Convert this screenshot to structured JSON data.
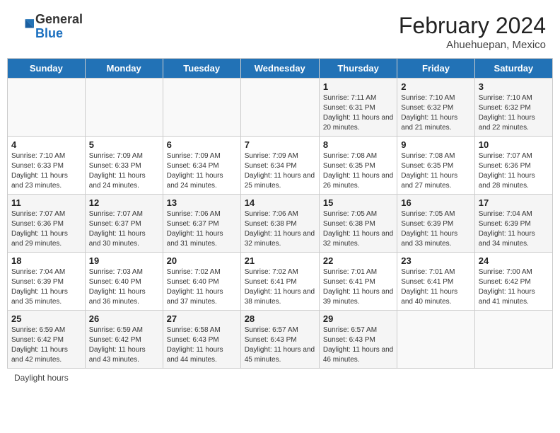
{
  "header": {
    "logo_general": "General",
    "logo_blue": "Blue",
    "month_year": "February 2024",
    "location": "Ahuehuepan, Mexico"
  },
  "calendar": {
    "days_of_week": [
      "Sunday",
      "Monday",
      "Tuesday",
      "Wednesday",
      "Thursday",
      "Friday",
      "Saturday"
    ],
    "weeks": [
      [
        {
          "day": "",
          "info": ""
        },
        {
          "day": "",
          "info": ""
        },
        {
          "day": "",
          "info": ""
        },
        {
          "day": "",
          "info": ""
        },
        {
          "day": "1",
          "info": "Sunrise: 7:11 AM\nSunset: 6:31 PM\nDaylight: 11 hours and 20 minutes."
        },
        {
          "day": "2",
          "info": "Sunrise: 7:10 AM\nSunset: 6:32 PM\nDaylight: 11 hours and 21 minutes."
        },
        {
          "day": "3",
          "info": "Sunrise: 7:10 AM\nSunset: 6:32 PM\nDaylight: 11 hours and 22 minutes."
        }
      ],
      [
        {
          "day": "4",
          "info": "Sunrise: 7:10 AM\nSunset: 6:33 PM\nDaylight: 11 hours and 23 minutes."
        },
        {
          "day": "5",
          "info": "Sunrise: 7:09 AM\nSunset: 6:33 PM\nDaylight: 11 hours and 24 minutes."
        },
        {
          "day": "6",
          "info": "Sunrise: 7:09 AM\nSunset: 6:34 PM\nDaylight: 11 hours and 24 minutes."
        },
        {
          "day": "7",
          "info": "Sunrise: 7:09 AM\nSunset: 6:34 PM\nDaylight: 11 hours and 25 minutes."
        },
        {
          "day": "8",
          "info": "Sunrise: 7:08 AM\nSunset: 6:35 PM\nDaylight: 11 hours and 26 minutes."
        },
        {
          "day": "9",
          "info": "Sunrise: 7:08 AM\nSunset: 6:35 PM\nDaylight: 11 hours and 27 minutes."
        },
        {
          "day": "10",
          "info": "Sunrise: 7:07 AM\nSunset: 6:36 PM\nDaylight: 11 hours and 28 minutes."
        }
      ],
      [
        {
          "day": "11",
          "info": "Sunrise: 7:07 AM\nSunset: 6:36 PM\nDaylight: 11 hours and 29 minutes."
        },
        {
          "day": "12",
          "info": "Sunrise: 7:07 AM\nSunset: 6:37 PM\nDaylight: 11 hours and 30 minutes."
        },
        {
          "day": "13",
          "info": "Sunrise: 7:06 AM\nSunset: 6:37 PM\nDaylight: 11 hours and 31 minutes."
        },
        {
          "day": "14",
          "info": "Sunrise: 7:06 AM\nSunset: 6:38 PM\nDaylight: 11 hours and 32 minutes."
        },
        {
          "day": "15",
          "info": "Sunrise: 7:05 AM\nSunset: 6:38 PM\nDaylight: 11 hours and 32 minutes."
        },
        {
          "day": "16",
          "info": "Sunrise: 7:05 AM\nSunset: 6:39 PM\nDaylight: 11 hours and 33 minutes."
        },
        {
          "day": "17",
          "info": "Sunrise: 7:04 AM\nSunset: 6:39 PM\nDaylight: 11 hours and 34 minutes."
        }
      ],
      [
        {
          "day": "18",
          "info": "Sunrise: 7:04 AM\nSunset: 6:39 PM\nDaylight: 11 hours and 35 minutes."
        },
        {
          "day": "19",
          "info": "Sunrise: 7:03 AM\nSunset: 6:40 PM\nDaylight: 11 hours and 36 minutes."
        },
        {
          "day": "20",
          "info": "Sunrise: 7:02 AM\nSunset: 6:40 PM\nDaylight: 11 hours and 37 minutes."
        },
        {
          "day": "21",
          "info": "Sunrise: 7:02 AM\nSunset: 6:41 PM\nDaylight: 11 hours and 38 minutes."
        },
        {
          "day": "22",
          "info": "Sunrise: 7:01 AM\nSunset: 6:41 PM\nDaylight: 11 hours and 39 minutes."
        },
        {
          "day": "23",
          "info": "Sunrise: 7:01 AM\nSunset: 6:41 PM\nDaylight: 11 hours and 40 minutes."
        },
        {
          "day": "24",
          "info": "Sunrise: 7:00 AM\nSunset: 6:42 PM\nDaylight: 11 hours and 41 minutes."
        }
      ],
      [
        {
          "day": "25",
          "info": "Sunrise: 6:59 AM\nSunset: 6:42 PM\nDaylight: 11 hours and 42 minutes."
        },
        {
          "day": "26",
          "info": "Sunrise: 6:59 AM\nSunset: 6:42 PM\nDaylight: 11 hours and 43 minutes."
        },
        {
          "day": "27",
          "info": "Sunrise: 6:58 AM\nSunset: 6:43 PM\nDaylight: 11 hours and 44 minutes."
        },
        {
          "day": "28",
          "info": "Sunrise: 6:57 AM\nSunset: 6:43 PM\nDaylight: 11 hours and 45 minutes."
        },
        {
          "day": "29",
          "info": "Sunrise: 6:57 AM\nSunset: 6:43 PM\nDaylight: 11 hours and 46 minutes."
        },
        {
          "day": "",
          "info": ""
        },
        {
          "day": "",
          "info": ""
        }
      ]
    ]
  },
  "legend": {
    "daylight_hours": "Daylight hours"
  }
}
